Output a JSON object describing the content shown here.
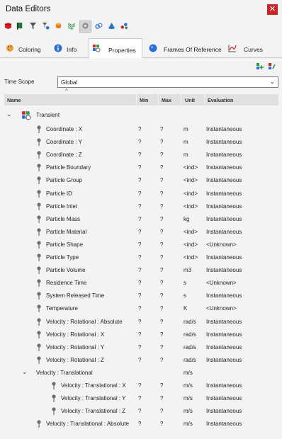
{
  "window": {
    "title": "Data Editors",
    "close_glyph": "✕"
  },
  "toolbar_icons": [
    "cube-red-icon",
    "flag-green-icon",
    "filter-icon",
    "settings-filter-icon",
    "cylinder-icon",
    "waves-icon",
    "gear-circle-icon",
    "link-icon",
    "cone-blue-icon",
    "molecules-icon"
  ],
  "tabs": [
    {
      "label": "Coloring",
      "icon": "palette-icon"
    },
    {
      "label": "Info",
      "icon": "info-icon"
    },
    {
      "label": "Properties",
      "icon": "properties-icon"
    },
    {
      "label": "Frames Of Reference",
      "icon": "sphere-icon"
    },
    {
      "label": "Curves",
      "icon": "curve-icon"
    }
  ],
  "time_scope": {
    "label": "Time Scope",
    "value": "Global"
  },
  "columns": {
    "name": "Name",
    "min": "Min",
    "max": "Max",
    "unit": "Unit",
    "evaluation": "Evaluation"
  },
  "group": {
    "label": "Transient"
  },
  "rows": [
    {
      "name": "Coordinate : X",
      "min": "?",
      "max": "?",
      "unit": "m",
      "eval": "Instantaneous"
    },
    {
      "name": "Coordinate : Y",
      "min": "?",
      "max": "?",
      "unit": "m",
      "eval": "Instantaneous"
    },
    {
      "name": "Coordinate : Z",
      "min": "?",
      "max": "?",
      "unit": "m",
      "eval": "Instantaneous"
    },
    {
      "name": "Particle Boundary",
      "min": "?",
      "max": "?",
      "unit": "<ind>",
      "eval": "Instantaneous"
    },
    {
      "name": "Particle Group",
      "min": "?",
      "max": "?",
      "unit": "<ind>",
      "eval": "Instantaneous"
    },
    {
      "name": "Particle ID",
      "min": "?",
      "max": "?",
      "unit": "<ind>",
      "eval": "Instantaneous"
    },
    {
      "name": "Particle Inlet",
      "min": "?",
      "max": "?",
      "unit": "<ind>",
      "eval": "Instantaneous"
    },
    {
      "name": "Particle Mass",
      "min": "?",
      "max": "?",
      "unit": "kg",
      "eval": "Instantaneous"
    },
    {
      "name": "Particle Material",
      "min": "?",
      "max": "?",
      "unit": "<ind>",
      "eval": "Instantaneous"
    },
    {
      "name": "Particle Shape",
      "min": "?",
      "max": "?",
      "unit": "<ind>",
      "eval": "<Unknown>"
    },
    {
      "name": "Particle Type",
      "min": "?",
      "max": "?",
      "unit": "<ind>",
      "eval": "Instantaneous"
    },
    {
      "name": "Particle Volume",
      "min": "?",
      "max": "?",
      "unit": "m3",
      "eval": "Instantaneous"
    },
    {
      "name": "Residence Time",
      "min": "?",
      "max": "?",
      "unit": "s",
      "eval": "<Unknown>"
    },
    {
      "name": "System Released Time",
      "min": "?",
      "max": "?",
      "unit": "s",
      "eval": "Instantaneous"
    },
    {
      "name": "Temperature",
      "min": "?",
      "max": "?",
      "unit": "K",
      "eval": "<Unknown>"
    },
    {
      "name": "Velocity : Rotational : Absolute",
      "min": "?",
      "max": "?",
      "unit": "rad/s",
      "eval": "Instantaneous"
    },
    {
      "name": "Velocity : Rotational : X",
      "min": "?",
      "max": "?",
      "unit": "rad/s",
      "eval": "Instantaneous"
    },
    {
      "name": "Velocity : Rotational : Y",
      "min": "?",
      "max": "?",
      "unit": "rad/s",
      "eval": "Instantaneous"
    },
    {
      "name": "Velocity : Rotational : Z",
      "min": "?",
      "max": "?",
      "unit": "rad/s",
      "eval": "Instantaneous"
    },
    {
      "name": "Velocity : Translational",
      "min": "",
      "max": "",
      "unit": "m/s",
      "eval": "",
      "kind": "group"
    },
    {
      "name": "Velocity : Translational : X",
      "min": "?",
      "max": "?",
      "unit": "m/s",
      "eval": "Instantaneous",
      "kind": "child"
    },
    {
      "name": "Velocity : Translational : Y",
      "min": "?",
      "max": "?",
      "unit": "m/s",
      "eval": "Instantaneous",
      "kind": "child"
    },
    {
      "name": "Velocity : Translational : Z",
      "min": "?",
      "max": "?",
      "unit": "m/s",
      "eval": "Instantaneous",
      "kind": "child"
    },
    {
      "name": "Velocity : Translational : Absolute",
      "min": "?",
      "max": "?",
      "unit": "m/s",
      "eval": "Instantaneous"
    }
  ]
}
